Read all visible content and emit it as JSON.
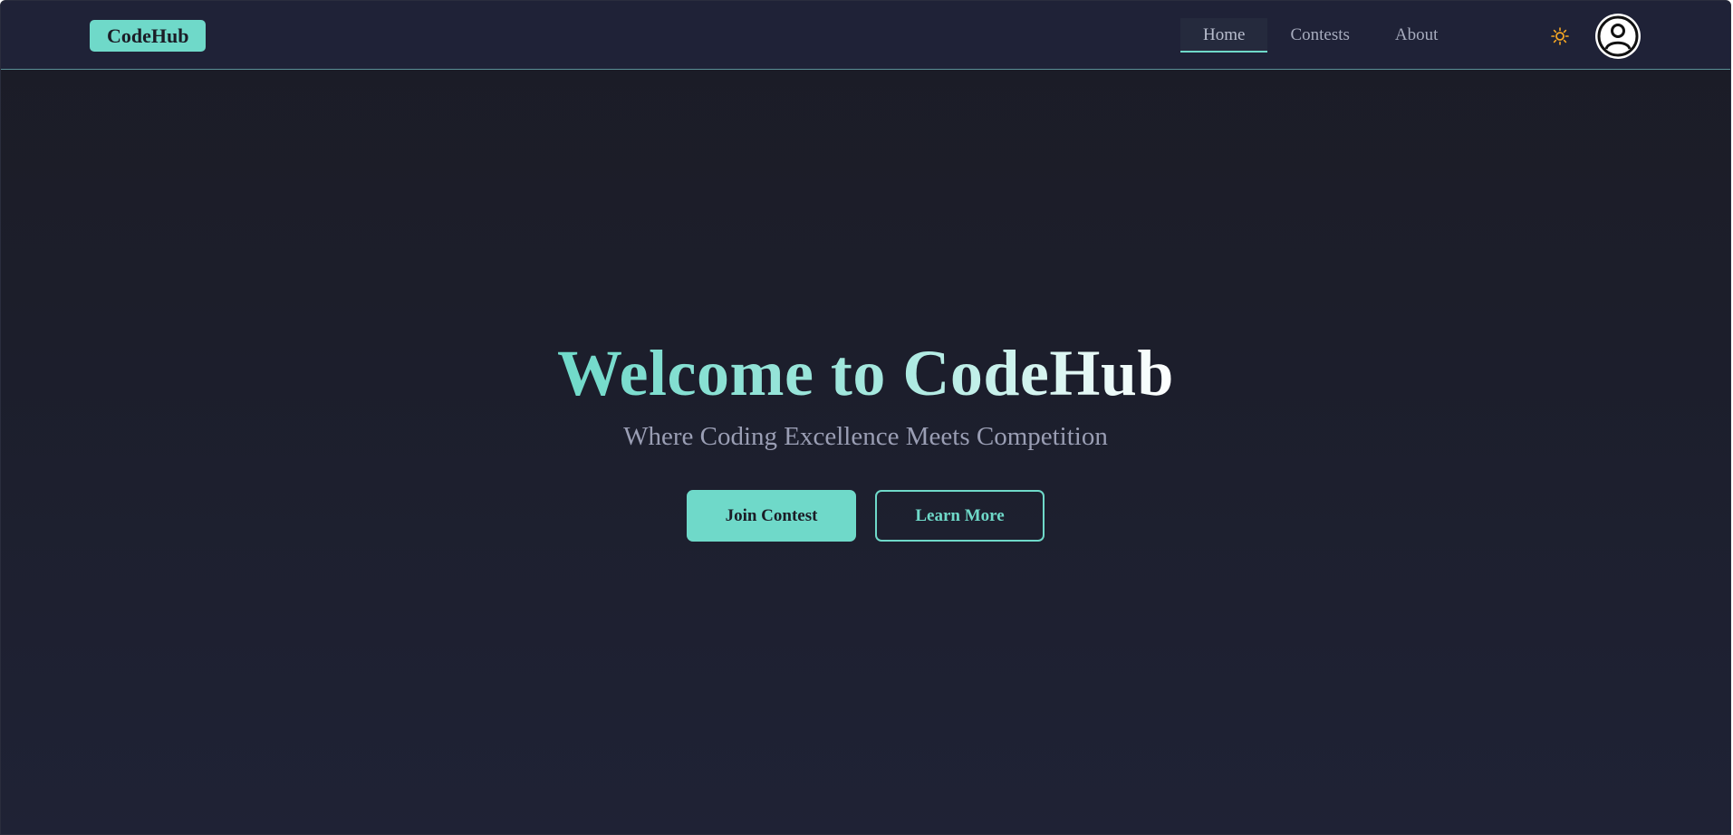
{
  "navbar": {
    "logo": "CodeHub",
    "links": [
      {
        "label": "Home",
        "active": true
      },
      {
        "label": "Contests",
        "active": false
      },
      {
        "label": "About",
        "active": false
      }
    ],
    "theme_icon": "sun-icon",
    "avatar_icon": "user-icon"
  },
  "hero": {
    "title": "Welcome to CodeHub",
    "subtitle": "Where Coding Excellence Meets Competition",
    "primary_button": "Join Contest",
    "secondary_button": "Learn More"
  },
  "colors": {
    "accent": "#6fd9c9",
    "background": "#1c1e2b",
    "navbar": "#1f2237",
    "sun": "#f5a623"
  }
}
